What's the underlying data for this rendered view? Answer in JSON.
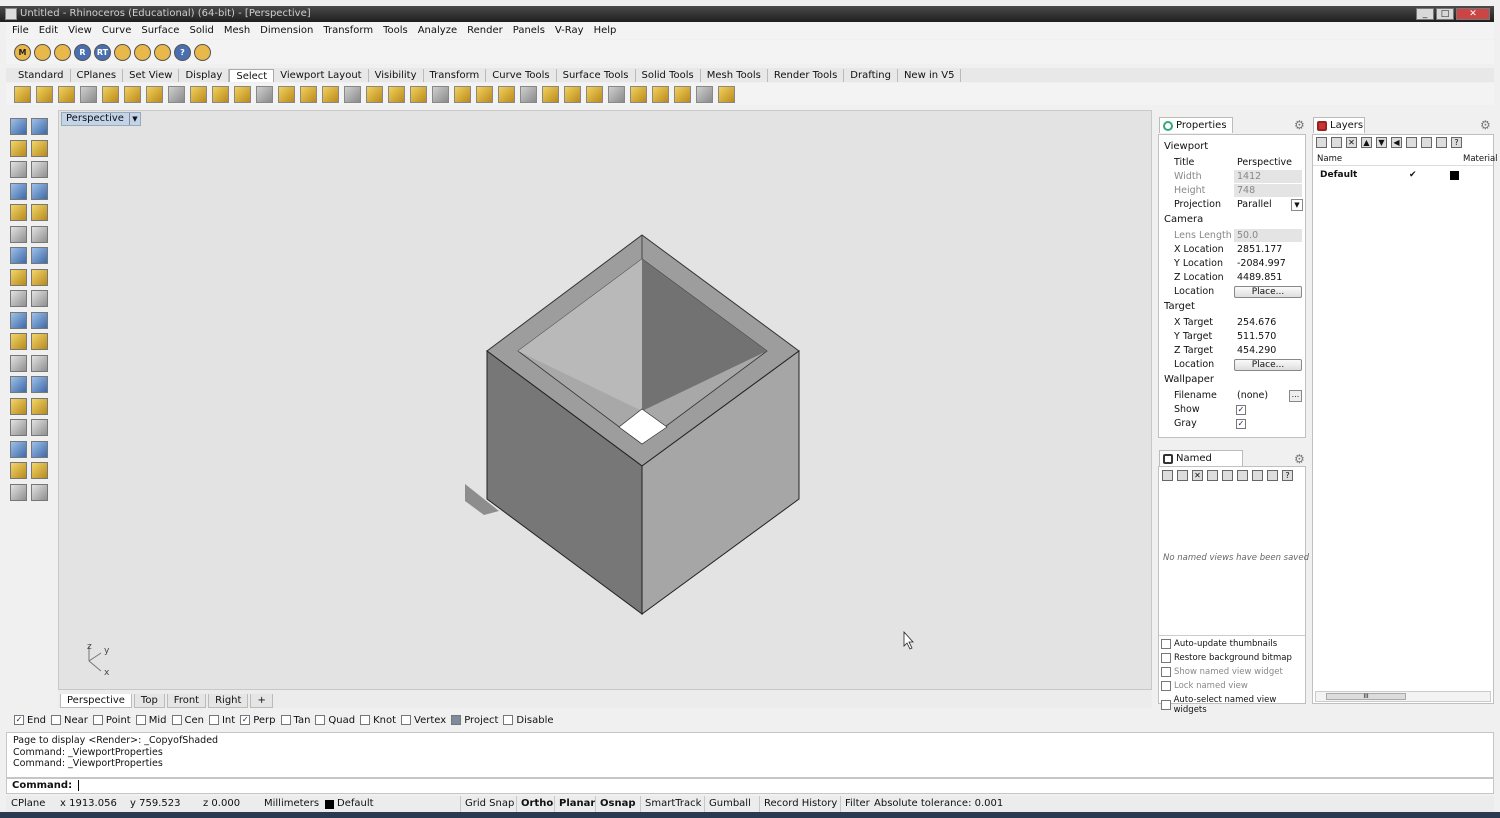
{
  "window": {
    "title": "Untitled - Rhinoceros (Educational) (64-bit) - [Perspective]",
    "min": "_",
    "max": "□",
    "close": "✕"
  },
  "menu": [
    "File",
    "Edit",
    "View",
    "Curve",
    "Surface",
    "Solid",
    "Mesh",
    "Dimension",
    "Transform",
    "Tools",
    "Analyze",
    "Render",
    "Panels",
    "V-Ray",
    "Help"
  ],
  "cmd_icons": [
    {
      "label": "M",
      "icon": "m-icon"
    },
    {
      "label": "",
      "icon": "tag-icon"
    },
    {
      "label": "",
      "icon": "tag2-icon"
    },
    {
      "label": "R",
      "icon": "render-r-icon"
    },
    {
      "label": "RT",
      "icon": "render-rt-icon"
    },
    {
      "label": "",
      "icon": "wand-icon"
    },
    {
      "label": "",
      "icon": "sun-icon"
    },
    {
      "label": "",
      "icon": "environment-icon"
    },
    {
      "label": "?",
      "icon": "help-icon"
    },
    {
      "label": "",
      "icon": "vray-icon"
    }
  ],
  "toolbar_tabs": [
    "Standard",
    "CPlanes",
    "Set View",
    "Display",
    "Select",
    "Viewport Layout",
    "Visibility",
    "Transform",
    "Curve Tools",
    "Surface Tools",
    "Solid Tools",
    "Mesh Tools",
    "Render Tools",
    "Drafting",
    "New in V5"
  ],
  "active_toolbar_tab": "Select",
  "viewport": {
    "label": "Perspective",
    "axis": {
      "z": "z",
      "y": "y",
      "x": "x"
    }
  },
  "viewport_tabs": [
    "Perspective",
    "Top",
    "Front",
    "Right",
    "+"
  ],
  "osnaps": [
    {
      "label": "End",
      "checked": true
    },
    {
      "label": "Near",
      "checked": false
    },
    {
      "label": "Point",
      "checked": false
    },
    {
      "label": "Mid",
      "checked": false
    },
    {
      "label": "Cen",
      "checked": false
    },
    {
      "label": "Int",
      "checked": false
    },
    {
      "label": "Perp",
      "checked": true
    },
    {
      "label": "Tan",
      "checked": false
    },
    {
      "label": "Quad",
      "checked": false
    },
    {
      "label": "Knot",
      "checked": false
    },
    {
      "label": "Vertex",
      "checked": false
    },
    {
      "label": "Project",
      "checked": false
    },
    {
      "label": "Disable",
      "checked": false
    }
  ],
  "history": [
    "Page to display <Render>: _CopyofShaded",
    "Command: _ViewportProperties",
    "Command: _ViewportProperties"
  ],
  "command_prompt": "Command:",
  "status": {
    "cplane": "CPlane",
    "x": "x 1913.056",
    "y": "y 759.523",
    "z": "z 0.000",
    "units": "Millimeters",
    "layer": "Default",
    "buttons": [
      "Grid Snap",
      "Ortho",
      "Planar",
      "Osnap",
      "SmartTrack",
      "Gumball",
      "Record History",
      "Filter"
    ],
    "tolerance": "Absolute tolerance: 0.001"
  },
  "properties": {
    "tab": "Properties",
    "viewport_head": "Viewport",
    "title_k": "Title",
    "title_v": "Perspective",
    "width_k": "Width",
    "width_v": "1412",
    "height_k": "Height",
    "height_v": "748",
    "proj_k": "Projection",
    "proj_v": "Parallel",
    "camera_head": "Camera",
    "lens_k": "Lens Length",
    "lens_v": "50.0",
    "xloc_k": "X Location",
    "xloc_v": "2851.177",
    "yloc_k": "Y Location",
    "yloc_v": "-2084.997",
    "zloc_k": "Z Location",
    "zloc_v": "4489.851",
    "loc_k": "Location",
    "place": "Place...",
    "target_head": "Target",
    "xt_k": "X Target",
    "xt_v": "254.676",
    "yt_k": "Y Target",
    "yt_v": "511.570",
    "zt_k": "Z Target",
    "zt_v": "454.290",
    "loc2_k": "Location",
    "wall_head": "Wallpaper",
    "file_k": "Filename",
    "file_v": "(none)",
    "browse": "...",
    "show_k": "Show",
    "gray_k": "Gray"
  },
  "named_views": {
    "tab": "Named Views",
    "empty": "No named views have been saved",
    "options": [
      {
        "label": "Auto-update thumbnails",
        "dim": false
      },
      {
        "label": "Restore background bitmap",
        "dim": false
      },
      {
        "label": "Show named view widget",
        "dim": true
      },
      {
        "label": "Lock named view",
        "dim": true
      },
      {
        "label": "Auto-select named view widgets",
        "dim": false
      }
    ]
  },
  "layers": {
    "tab": "Layers",
    "col_name": "Name",
    "col_material": "Material",
    "rows": [
      {
        "name": "Default",
        "current": "✔",
        "color": "#000000"
      }
    ],
    "scroll_grip": "III"
  },
  "colors": {
    "accent": "#c3d3e8",
    "model_dark": "#6f6f6f",
    "model_mid": "#8c8c8c",
    "model_light": "#a9a9a9"
  }
}
